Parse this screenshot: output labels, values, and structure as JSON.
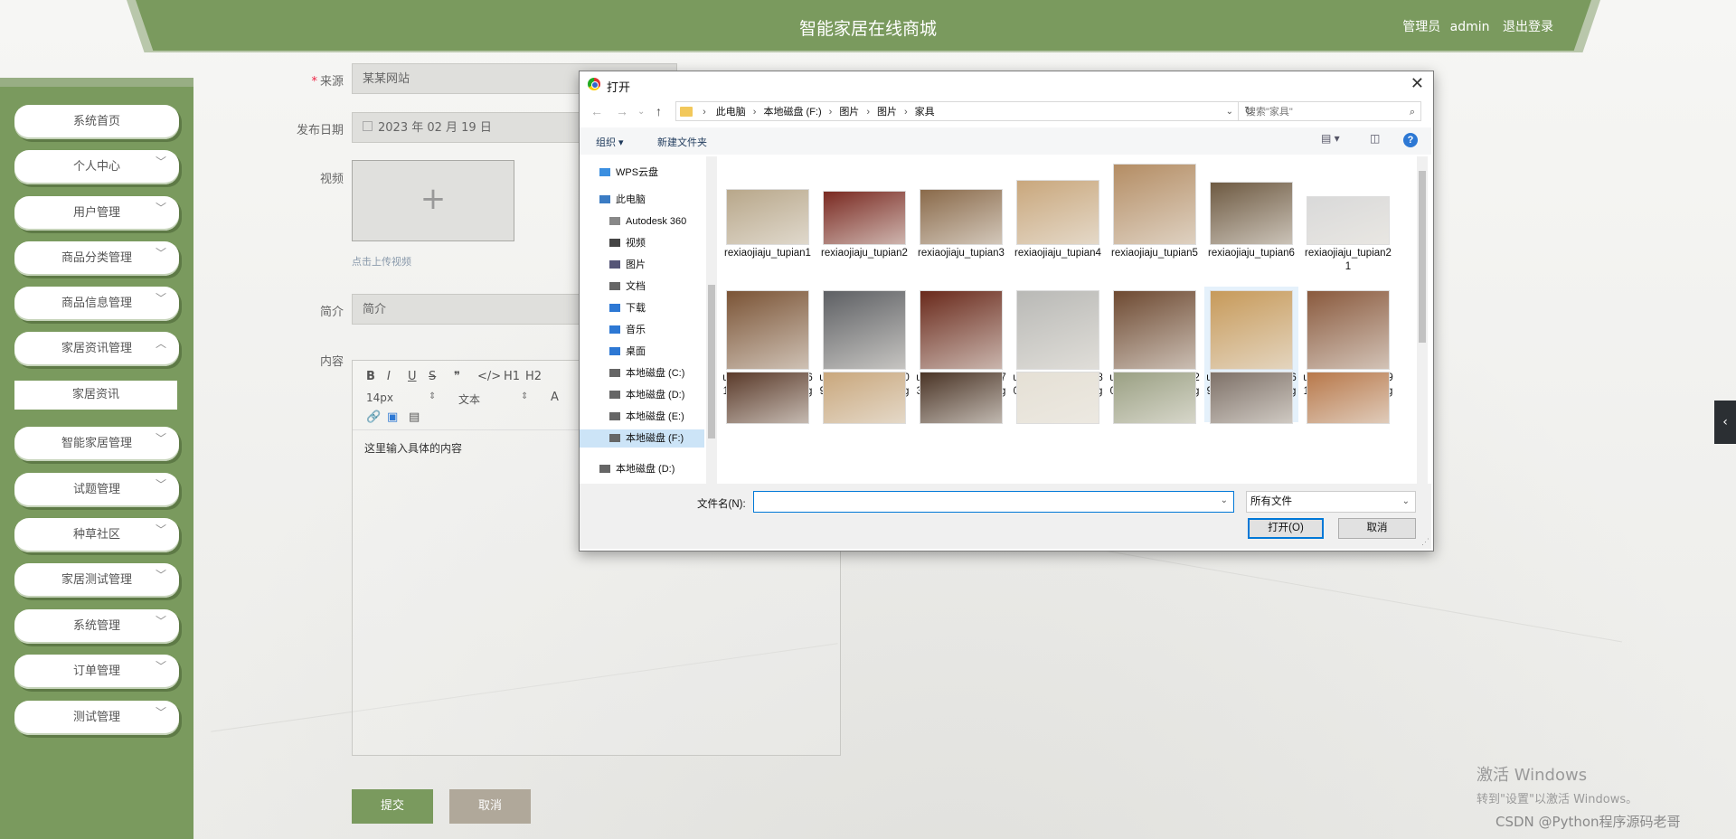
{
  "header": {
    "title": "智能家居在线商城",
    "role": "管理员",
    "username": "admin",
    "logout": "退出登录"
  },
  "sidebar": {
    "items": [
      {
        "label": "系统首页",
        "chevron": ""
      },
      {
        "label": "个人中心",
        "chevron": "﹀"
      },
      {
        "label": "用户管理",
        "chevron": "﹀"
      },
      {
        "label": "商品分类管理",
        "chevron": "﹀"
      },
      {
        "label": "商品信息管理",
        "chevron": "﹀"
      },
      {
        "label": "家居资讯管理",
        "chevron": "︿"
      },
      {
        "label": "家居资讯",
        "chevron": ""
      },
      {
        "label": "智能家居管理",
        "chevron": "﹀"
      },
      {
        "label": "试题管理",
        "chevron": "﹀"
      },
      {
        "label": "种草社区",
        "chevron": "﹀"
      },
      {
        "label": "家居测试管理",
        "chevron": "﹀"
      },
      {
        "label": "系统管理",
        "chevron": "﹀"
      },
      {
        "label": "订单管理",
        "chevron": "﹀"
      },
      {
        "label": "测试管理",
        "chevron": "﹀"
      }
    ]
  },
  "form": {
    "source_label": "来源",
    "source_value": "某某网站",
    "date_label": "发布日期",
    "date_value": "2023 年 02 月 19 日",
    "video_label": "视频",
    "upload_plus": "+",
    "upload_hint": "点击上传视频",
    "intro_label": "简介",
    "intro_placeholder": "简介",
    "content_label": "内容",
    "editor_toolbar": [
      "B",
      "I",
      "U",
      "S",
      "❞",
      "</>",
      "H1",
      "H2"
    ],
    "editor_font_size": "14px",
    "editor_font_type": "文本",
    "editor_content": "这里输入具体的内容",
    "submit": "提交",
    "cancel": "取消"
  },
  "dialog": {
    "title": "打开",
    "close": "✕",
    "path": [
      "此电脑",
      "本地磁盘 (F:)",
      "图片",
      "图片",
      "家具"
    ],
    "search_placeholder": "搜索\"家具\"",
    "organize": "组织 ▾",
    "new_folder": "新建文件夹",
    "help": "?",
    "nav": [
      {
        "label": "WPS云盘",
        "indent": 1,
        "color": "#3b8fe0"
      },
      {
        "label": "此电脑",
        "indent": 1,
        "color": "#3b7cc4"
      },
      {
        "label": "Autodesk 360",
        "indent": 2,
        "color": "#888"
      },
      {
        "label": "视频",
        "indent": 2,
        "color": "#444"
      },
      {
        "label": "图片",
        "indent": 2,
        "color": "#557"
      },
      {
        "label": "文档",
        "indent": 2,
        "color": "#666"
      },
      {
        "label": "下载",
        "indent": 2,
        "color": "#2d78d4"
      },
      {
        "label": "音乐",
        "indent": 2,
        "color": "#2d78d4"
      },
      {
        "label": "桌面",
        "indent": 2,
        "color": "#2d78d4"
      },
      {
        "label": "本地磁盘 (C:)",
        "indent": 2,
        "color": "#666"
      },
      {
        "label": "本地磁盘 (D:)",
        "indent": 2,
        "color": "#666"
      },
      {
        "label": "本地磁盘 (E:)",
        "indent": 2,
        "color": "#666"
      },
      {
        "label": "本地磁盘 (F:)",
        "indent": 2,
        "color": "#666",
        "selected": true
      },
      {
        "label": "本地磁盘 (D:)",
        "indent": 1,
        "color": "#666"
      }
    ],
    "files": [
      {
        "name": "rexiaojiaju_tupian1",
        "color": "#b8a78a"
      },
      {
        "name": "rexiaojiaju_tupian2",
        "color": "#7a2a22"
      },
      {
        "name": "rexiaojiaju_tupian3",
        "color": "#8a6a4a"
      },
      {
        "name": "rexiaojiaju_tupian4",
        "color": "#c9a77c"
      },
      {
        "name": "rexiaojiaju_tupian5",
        "color": "#b48d64"
      },
      {
        "name": "rexiaojiaju_tupian6",
        "color": "#6e5a42"
      },
      {
        "name": "rexiaojiaju_tupian21",
        "color": "#d9d9d9"
      },
      {
        "name": "u=1072833122,1661922545&fm=26&gp=0",
        "color": "#7b5436"
      },
      {
        "name": "u=1880482843,5509986659&fm=26&gp=0",
        "color": "#5e6064"
      },
      {
        "name": "u=2013392762,3473104123&fm=26&gp=0",
        "color": "#6a2a1c"
      },
      {
        "name": "u=2527092079,1980976315&fm=26&gp=0",
        "color": "#b9b9b6"
      },
      {
        "name": "u=2604510806,9720146661&fm=26&gp=0",
        "color": "#6e4a32"
      },
      {
        "name": "u=2877465600,2869027504&fm=26&gp=0",
        "color": "#c79a5a",
        "selected": true
      },
      {
        "name": "u=2957674798,9391466618&fm=26&gp=0",
        "color": "#8a5a3e"
      },
      {
        "name": "",
        "color": "#5a3a2a"
      },
      {
        "name": "",
        "color": "#c9a77c"
      },
      {
        "name": "",
        "color": "#4a3426"
      },
      {
        "name": "",
        "color": "#e5e0d5"
      },
      {
        "name": "",
        "color": "#9aa083"
      },
      {
        "name": "",
        "color": "#7e7168"
      },
      {
        "name": "",
        "color": "#b8784a"
      }
    ],
    "filename_label": "文件名(N):",
    "filename_value": "",
    "filetype": "所有文件",
    "open": "打开(O)",
    "cancel": "取消"
  },
  "watermark": {
    "line1": "激活 Windows",
    "line2": "转到\"设置\"以激活 Windows。",
    "csdn": "CSDN @Python程序源码老哥"
  },
  "colors": {
    "theme_green": "#7a9a5e",
    "cancel_brown": "#b0a89a",
    "win_blue": "#0078d7"
  }
}
